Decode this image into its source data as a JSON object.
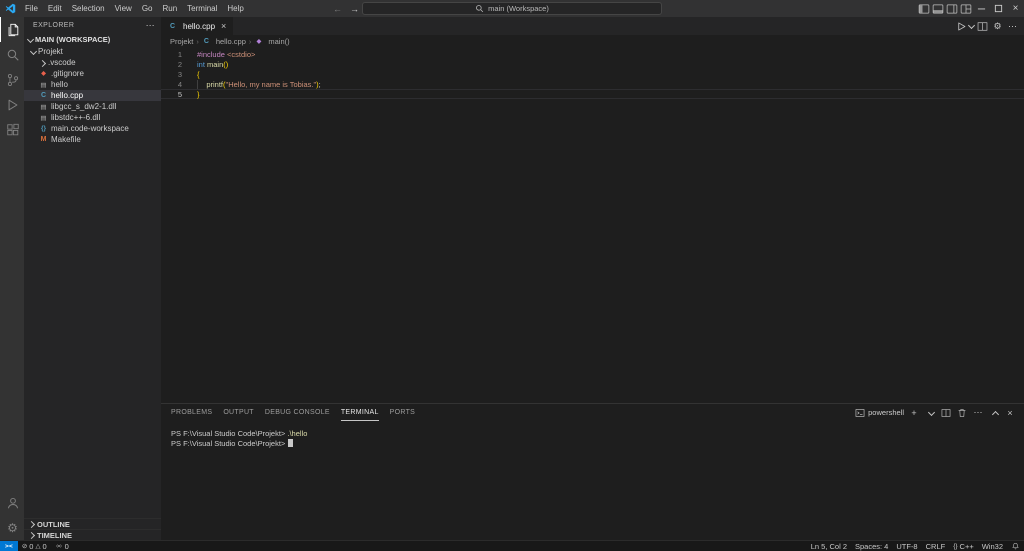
{
  "colors": {
    "titlebar": "#323233",
    "activitybar": "#333333",
    "sidebar": "#252526",
    "editor": "#1e1e1e",
    "statusbar": "#181818",
    "remote_blue": "#0078d4",
    "selection": "#37373d",
    "bracket_gold": "#ffd700",
    "string_orange": "#ce9178",
    "keyword_purple": "#c586c0",
    "type_blue": "#569cd6",
    "function_yellow": "#dcdcaa"
  },
  "icons": {
    "more": "⋯",
    "close": "×",
    "plus": "+",
    "back": "←",
    "forward": "→",
    "remote": "><",
    "error": "⊘",
    "warning": "△",
    "braces": "{}",
    "crumb_sep": "›",
    "gear": "⚙"
  },
  "titlebar": {
    "menus": [
      "File",
      "Edit",
      "Selection",
      "View",
      "Go",
      "Run",
      "Terminal",
      "Help"
    ],
    "search_label": "main (Workspace)"
  },
  "activitybar": {
    "active": "explorer",
    "top": [
      "explorer",
      "search",
      "source-control",
      "run-debug",
      "extensions"
    ],
    "bottom": [
      "account",
      "settings"
    ]
  },
  "sidebar": {
    "title": "EXPLORER",
    "section": "MAIN (WORKSPACE)",
    "tree": [
      {
        "label": "Projekt",
        "type": "folder-open",
        "indent": 0
      },
      {
        "label": ".vscode",
        "type": "folder",
        "indent": 1
      },
      {
        "label": ".gitignore",
        "type": "git",
        "indent": 1
      },
      {
        "label": "hello",
        "type": "file",
        "indent": 1
      },
      {
        "label": "hello.cpp",
        "type": "cpp",
        "indent": 1,
        "selected": true
      },
      {
        "label": "libgcc_s_dw2-1.dll",
        "type": "file",
        "indent": 1
      },
      {
        "label": "libstdc++-6.dll",
        "type": "file",
        "indent": 1
      },
      {
        "label": "main.code-workspace",
        "type": "workspace",
        "indent": 1
      },
      {
        "label": "Makefile",
        "type": "makefile",
        "indent": 1
      }
    ],
    "bottom_sections": [
      "OUTLINE",
      "TIMELINE"
    ]
  },
  "editor": {
    "tab": {
      "label": "hello.cpp"
    },
    "breadcrumbs": [
      {
        "label": "Projekt",
        "icon": ""
      },
      {
        "label": "hello.cpp",
        "icon": "cpp"
      },
      {
        "label": "main()",
        "icon": "method"
      }
    ],
    "lines": [
      {
        "num": "1",
        "segments": [
          {
            "type": "keyword",
            "text": "#include"
          },
          {
            "type": "plain",
            "text": " "
          },
          {
            "type": "string",
            "text": "<cstdio>"
          }
        ]
      },
      {
        "num": "2",
        "segments": [
          {
            "type": "type",
            "text": "int"
          },
          {
            "type": "plain",
            "text": " "
          },
          {
            "type": "function",
            "text": "main"
          },
          {
            "type": "bracket",
            "text": "()"
          }
        ]
      },
      {
        "num": "3",
        "segments": [
          {
            "type": "bracket",
            "text": "{"
          }
        ]
      },
      {
        "num": "4",
        "segments": [
          {
            "type": "indent",
            "text": "    "
          },
          {
            "type": "function",
            "text": "printf"
          },
          {
            "type": "bracket",
            "text": "("
          },
          {
            "type": "string",
            "text": "\"Hello, my name is Tobias.\""
          },
          {
            "type": "bracket",
            "text": ")"
          },
          {
            "type": "plain",
            "text": ";"
          }
        ]
      },
      {
        "num": "5",
        "segments": [
          {
            "type": "bracket",
            "text": "}"
          }
        ],
        "current": true
      }
    ]
  },
  "panel": {
    "tabs": [
      "PROBLEMS",
      "OUTPUT",
      "DEBUG CONSOLE",
      "TERMINAL",
      "PORTS"
    ],
    "active_tab": "TERMINAL",
    "shell_label": "powershell",
    "terminal_lines": [
      {
        "prompt": "PS F:\\Visual Studio Code\\Projekt>",
        "command": ".\\hello"
      },
      {
        "prompt": "PS F:\\Visual Studio Code\\Projekt>",
        "command": "",
        "cursor": true
      }
    ]
  },
  "statusbar": {
    "errors": "0",
    "warnings": "0",
    "ports": "0",
    "cursor_position": "Ln 5, Col 2",
    "indentation": "Spaces: 4",
    "encoding": "UTF-8",
    "eol": "CRLF",
    "language": "C++",
    "platform": "Win32"
  }
}
